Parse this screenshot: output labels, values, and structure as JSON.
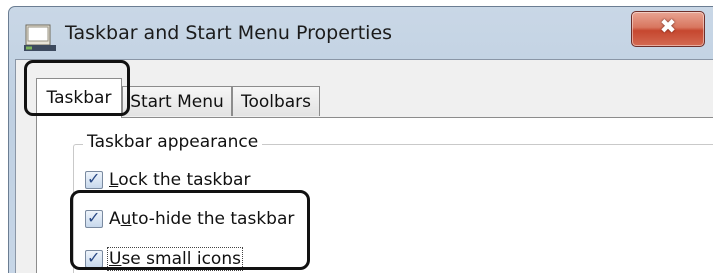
{
  "window": {
    "title": "Taskbar and Start Menu Properties",
    "close_label": "✖"
  },
  "tabs": [
    {
      "label": "Taskbar",
      "active": true
    },
    {
      "label": "Start Menu",
      "active": false
    },
    {
      "label": "Toolbars",
      "active": false
    }
  ],
  "taskbar_appearance": {
    "group_title": "Taskbar appearance",
    "options": [
      {
        "before": "",
        "accel": "L",
        "after": "ock the taskbar",
        "checked": true
      },
      {
        "before": "A",
        "accel": "u",
        "after": "to-hide the taskbar",
        "checked": true
      },
      {
        "before": "",
        "accel": "U",
        "after": "se small icons",
        "checked": true
      }
    ]
  },
  "icons": {
    "app": "taskbar-icon",
    "close": "close-icon",
    "check": "checkmark-icon"
  },
  "colors": {
    "title_bar": "#c9d7e6",
    "close_button": "#d8765f",
    "highlight": "#111111"
  }
}
